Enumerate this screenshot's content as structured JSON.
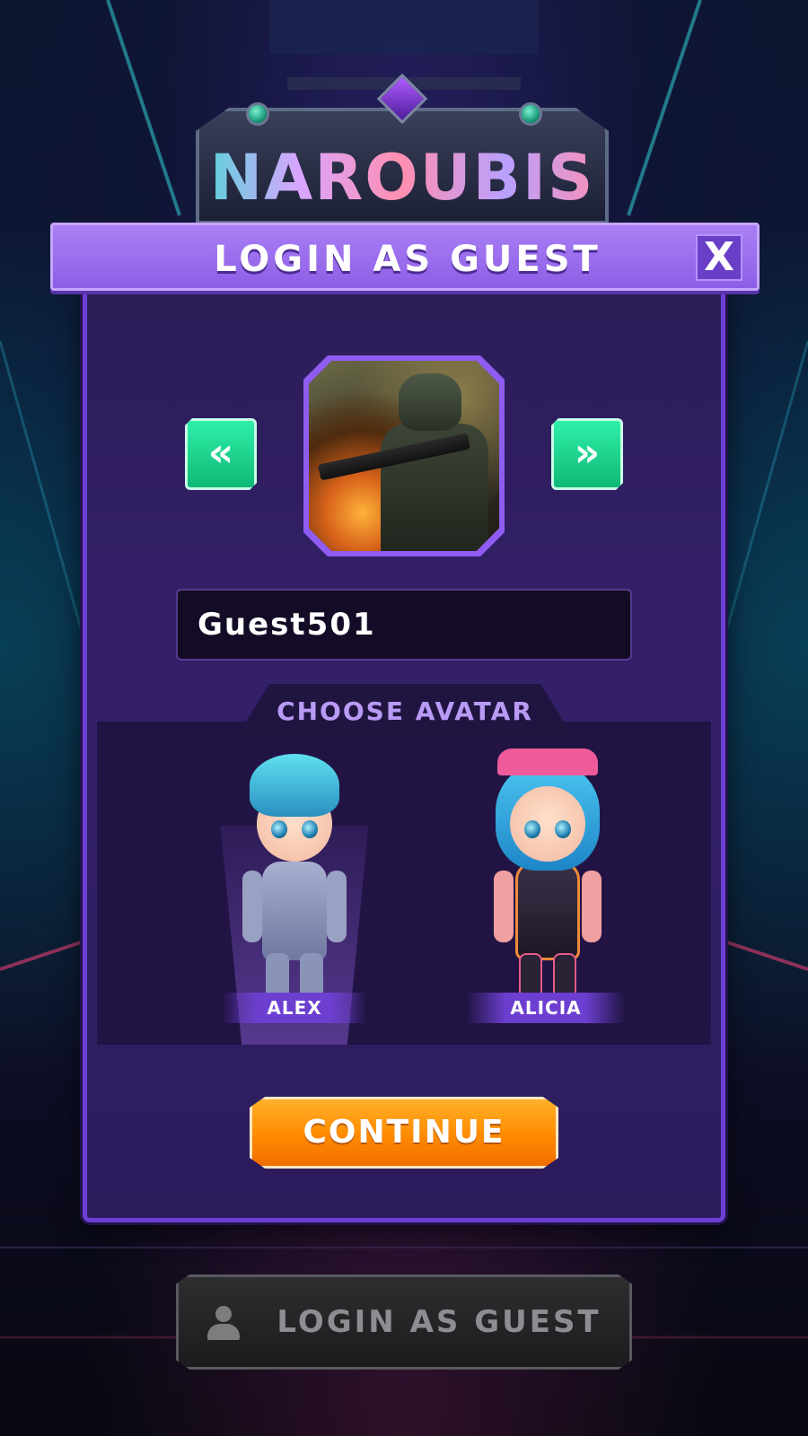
{
  "logo": {
    "text": "NAROUBIS"
  },
  "dialog": {
    "title": "LOGIN AS GUEST",
    "close_label": "X",
    "prev_icon": "double-chevron-left",
    "next_icon": "double-chevron-right",
    "name_value": "Guest501",
    "choose_avatar_label": "CHOOSE AVATAR",
    "avatars": [
      {
        "name": "ALEX",
        "hair_color": "#46c6e6",
        "suit_color": "#8b94b8",
        "selected": true
      },
      {
        "name": "ALICIA",
        "hair_color": "#3ab6e8",
        "suit_color": "#2a2235",
        "selected": false
      }
    ],
    "continue_label": "CONTINUE"
  },
  "bottom": {
    "login_label": "LOGIN AS GUEST",
    "icon": "user-icon"
  },
  "colors": {
    "accent_purple": "#8d5ee6",
    "arrow_green": "#1fd892",
    "continue_orange": "#ff8a00"
  }
}
